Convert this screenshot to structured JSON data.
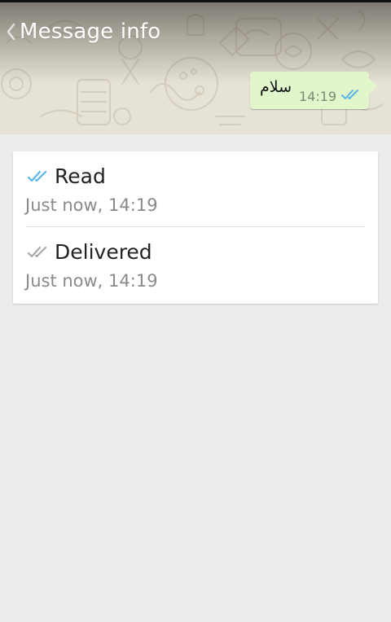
{
  "header": {
    "title": "Message info",
    "back_icon": "chevron-left-icon",
    "background_color": "#e6e2d6"
  },
  "message": {
    "text": "سلام",
    "time": "14:19",
    "status_icon": "double-check-icon",
    "bubble_color": "#e1f7cb",
    "tick_color": "#5ab6e6"
  },
  "receipts": [
    {
      "label": "Read",
      "time": "Just now, 14:19",
      "icon": "double-check-icon",
      "icon_color": "#5ab6e6"
    },
    {
      "label": "Delivered",
      "time": "Just now, 14:19",
      "icon": "double-check-icon",
      "icon_color": "#a8a8a8"
    }
  ],
  "colors": {
    "page_background": "#ececec",
    "card_background": "#ffffff"
  }
}
